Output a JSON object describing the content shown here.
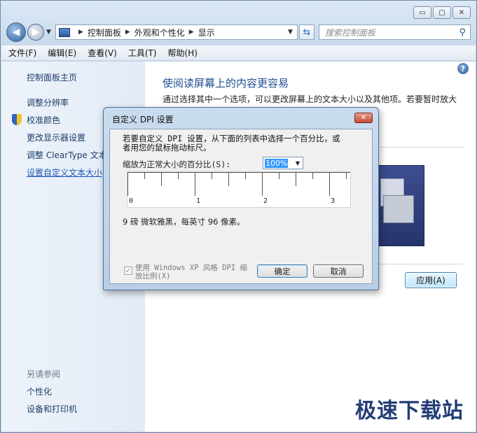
{
  "window": {
    "caption": {
      "minimize": "▭",
      "maximize": "▢",
      "close": "✕"
    }
  },
  "navbar": {
    "breadcrumb": [
      "控制面板",
      "外观和个性化",
      "显示"
    ],
    "search_placeholder": "搜索控制面板"
  },
  "menubar": {
    "items": [
      "文件(F)",
      "编辑(E)",
      "查看(V)",
      "工具(T)",
      "帮助(H)"
    ]
  },
  "left_pane": {
    "home": "控制面板主页",
    "items": [
      "调整分辨率",
      "校准颜色",
      "更改显示器设置",
      "调整 ClearType 文本",
      "设置自定义文本大小"
    ],
    "see_also_title": "另请参阅",
    "see_also": [
      "个性化",
      "设备和打印机"
    ]
  },
  "main": {
    "title": "使阅读屏幕上的内容更容易",
    "description": "通过选择其中一个选项，可以更改屏幕上的文本大小以及其他项。若要暂时放大",
    "apply_label": "应用(A)",
    "help": "?"
  },
  "dialog": {
    "title": "自定义 DPI 设置",
    "close": "✕",
    "instruction": "若要自定义 DPI 设置，从下面的列表中选择一个百分比，或者用您的鼠标拖动标尺。",
    "scale_label": "缩放为正常大小的百分比(S):",
    "scale_value": "100%",
    "ruler_labels": [
      "0",
      "1",
      "2",
      "3"
    ],
    "font_sample": "9 磅 微软雅黑，每英寸 96 像素。",
    "xp_checkbox_label": "使用 Windows XP 风格 DPI 缩放比例(X)",
    "xp_checkbox_checked": true,
    "ok_label": "确定",
    "cancel_label": "取消"
  },
  "watermark": "极速下载站",
  "colors": {
    "link": "#1f57b7",
    "title_blue": "#1d4f91",
    "close_red": "#c34a34"
  }
}
